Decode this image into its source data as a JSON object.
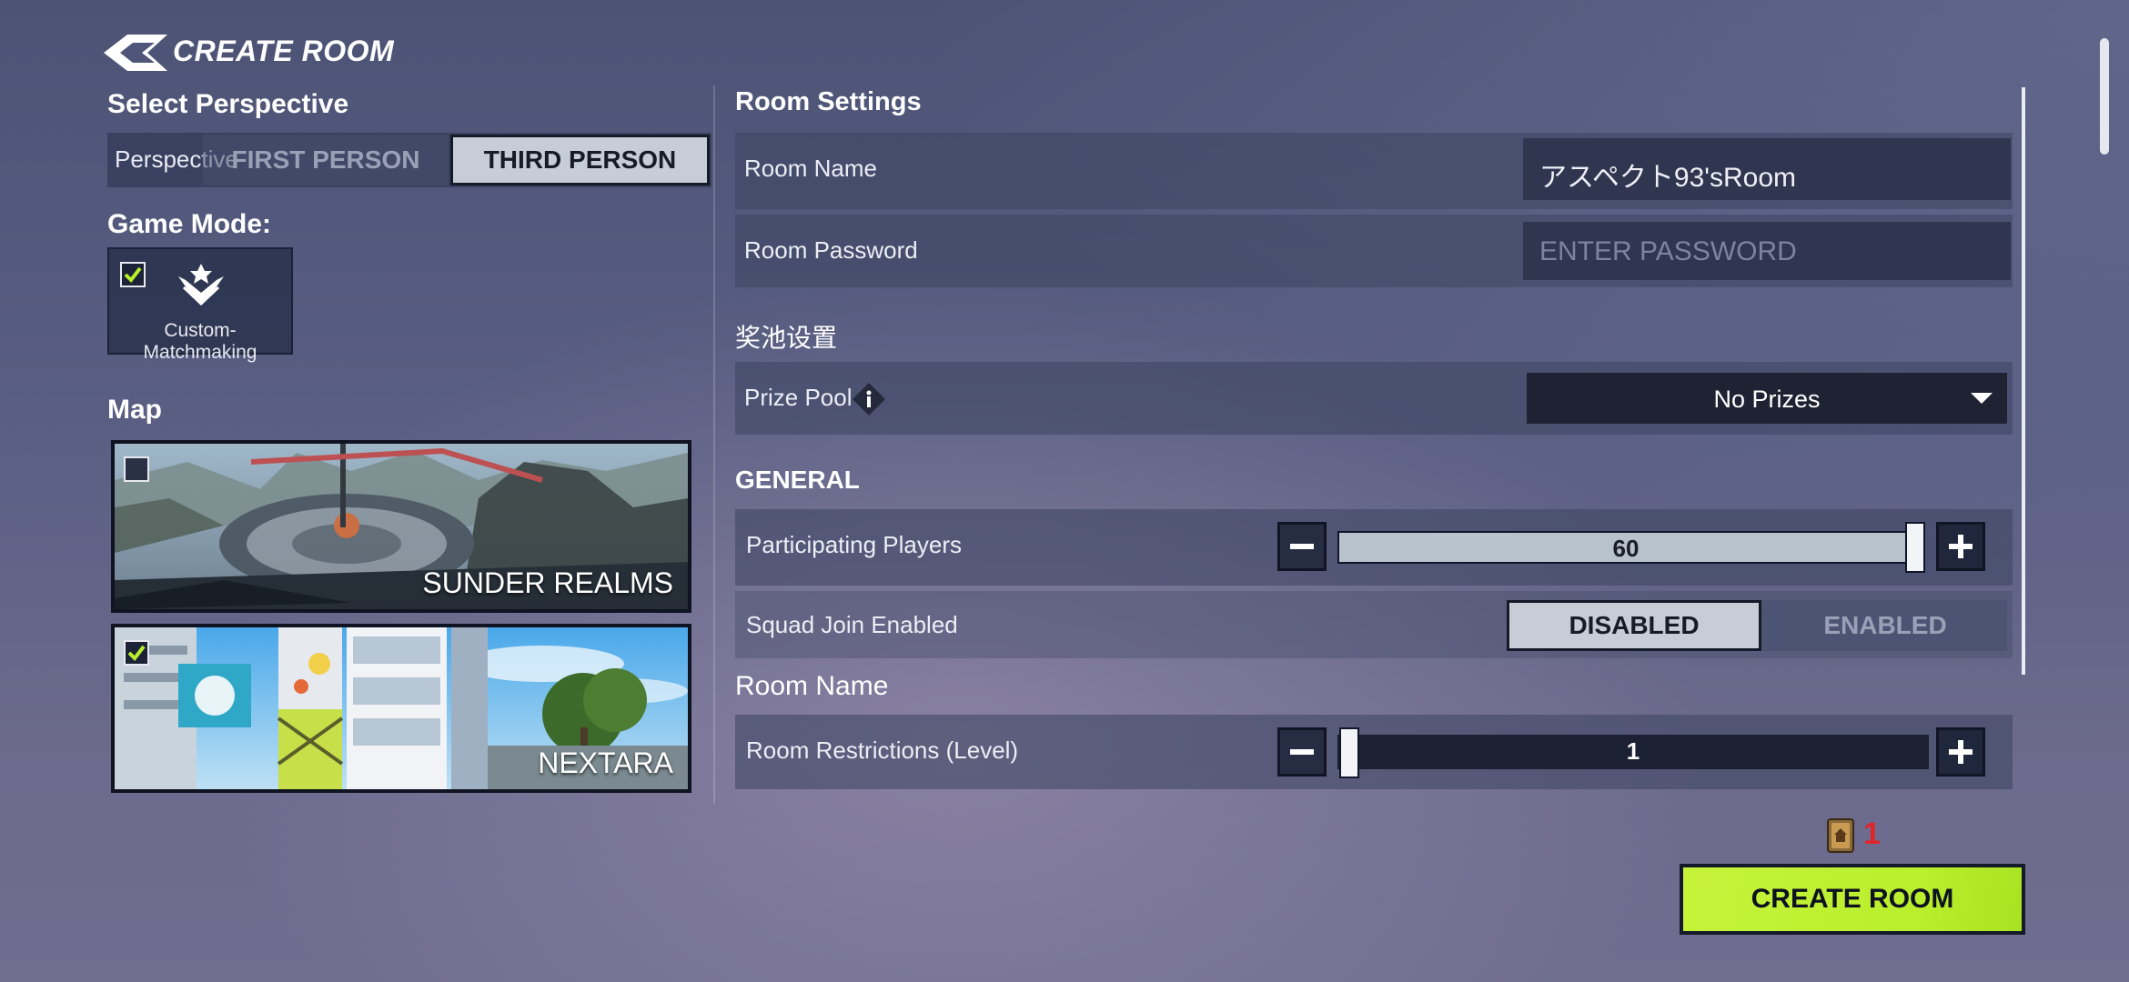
{
  "header": {
    "title": "CREATE ROOM"
  },
  "perspective": {
    "section_title": "Select Perspective",
    "label": "Perspective",
    "options": [
      "FIRST PERSON",
      "THIRD PERSON"
    ],
    "selected": "THIRD PERSON"
  },
  "game_mode": {
    "section_title": "Game Mode:",
    "mode_label": "Custom-Matchmaking",
    "checked": true
  },
  "map": {
    "section_title": "Map",
    "items": [
      {
        "name": "SUNDER REALMS",
        "checked": false
      },
      {
        "name": "NEXTARA",
        "checked": true
      }
    ]
  },
  "room_settings": {
    "section_title": "Room Settings",
    "room_name_label": "Room Name",
    "room_name_value": "アスペクト93'sRoom",
    "password_label": "Room Password",
    "password_placeholder": "ENTER PASSWORD"
  },
  "prize": {
    "section_title": "奖池设置",
    "label": "Prize Pool",
    "selected": "No Prizes"
  },
  "general": {
    "section_title": "GENERAL",
    "players_label": "Participating Players",
    "players_value": "60",
    "squad_label": "Squad Join Enabled",
    "squad_options": [
      "DISABLED",
      "ENABLED"
    ],
    "squad_selected": "DISABLED"
  },
  "restrictions": {
    "section_title": "Room Name",
    "label": "Room Restrictions (Level)",
    "value": "1"
  },
  "footer": {
    "ticket_count": "1",
    "create_button": "CREATE ROOM"
  },
  "colors": {
    "accent_green": "#c1f135",
    "selected_tab": "#c6cdd6",
    "ticket_red": "#e0242a"
  }
}
